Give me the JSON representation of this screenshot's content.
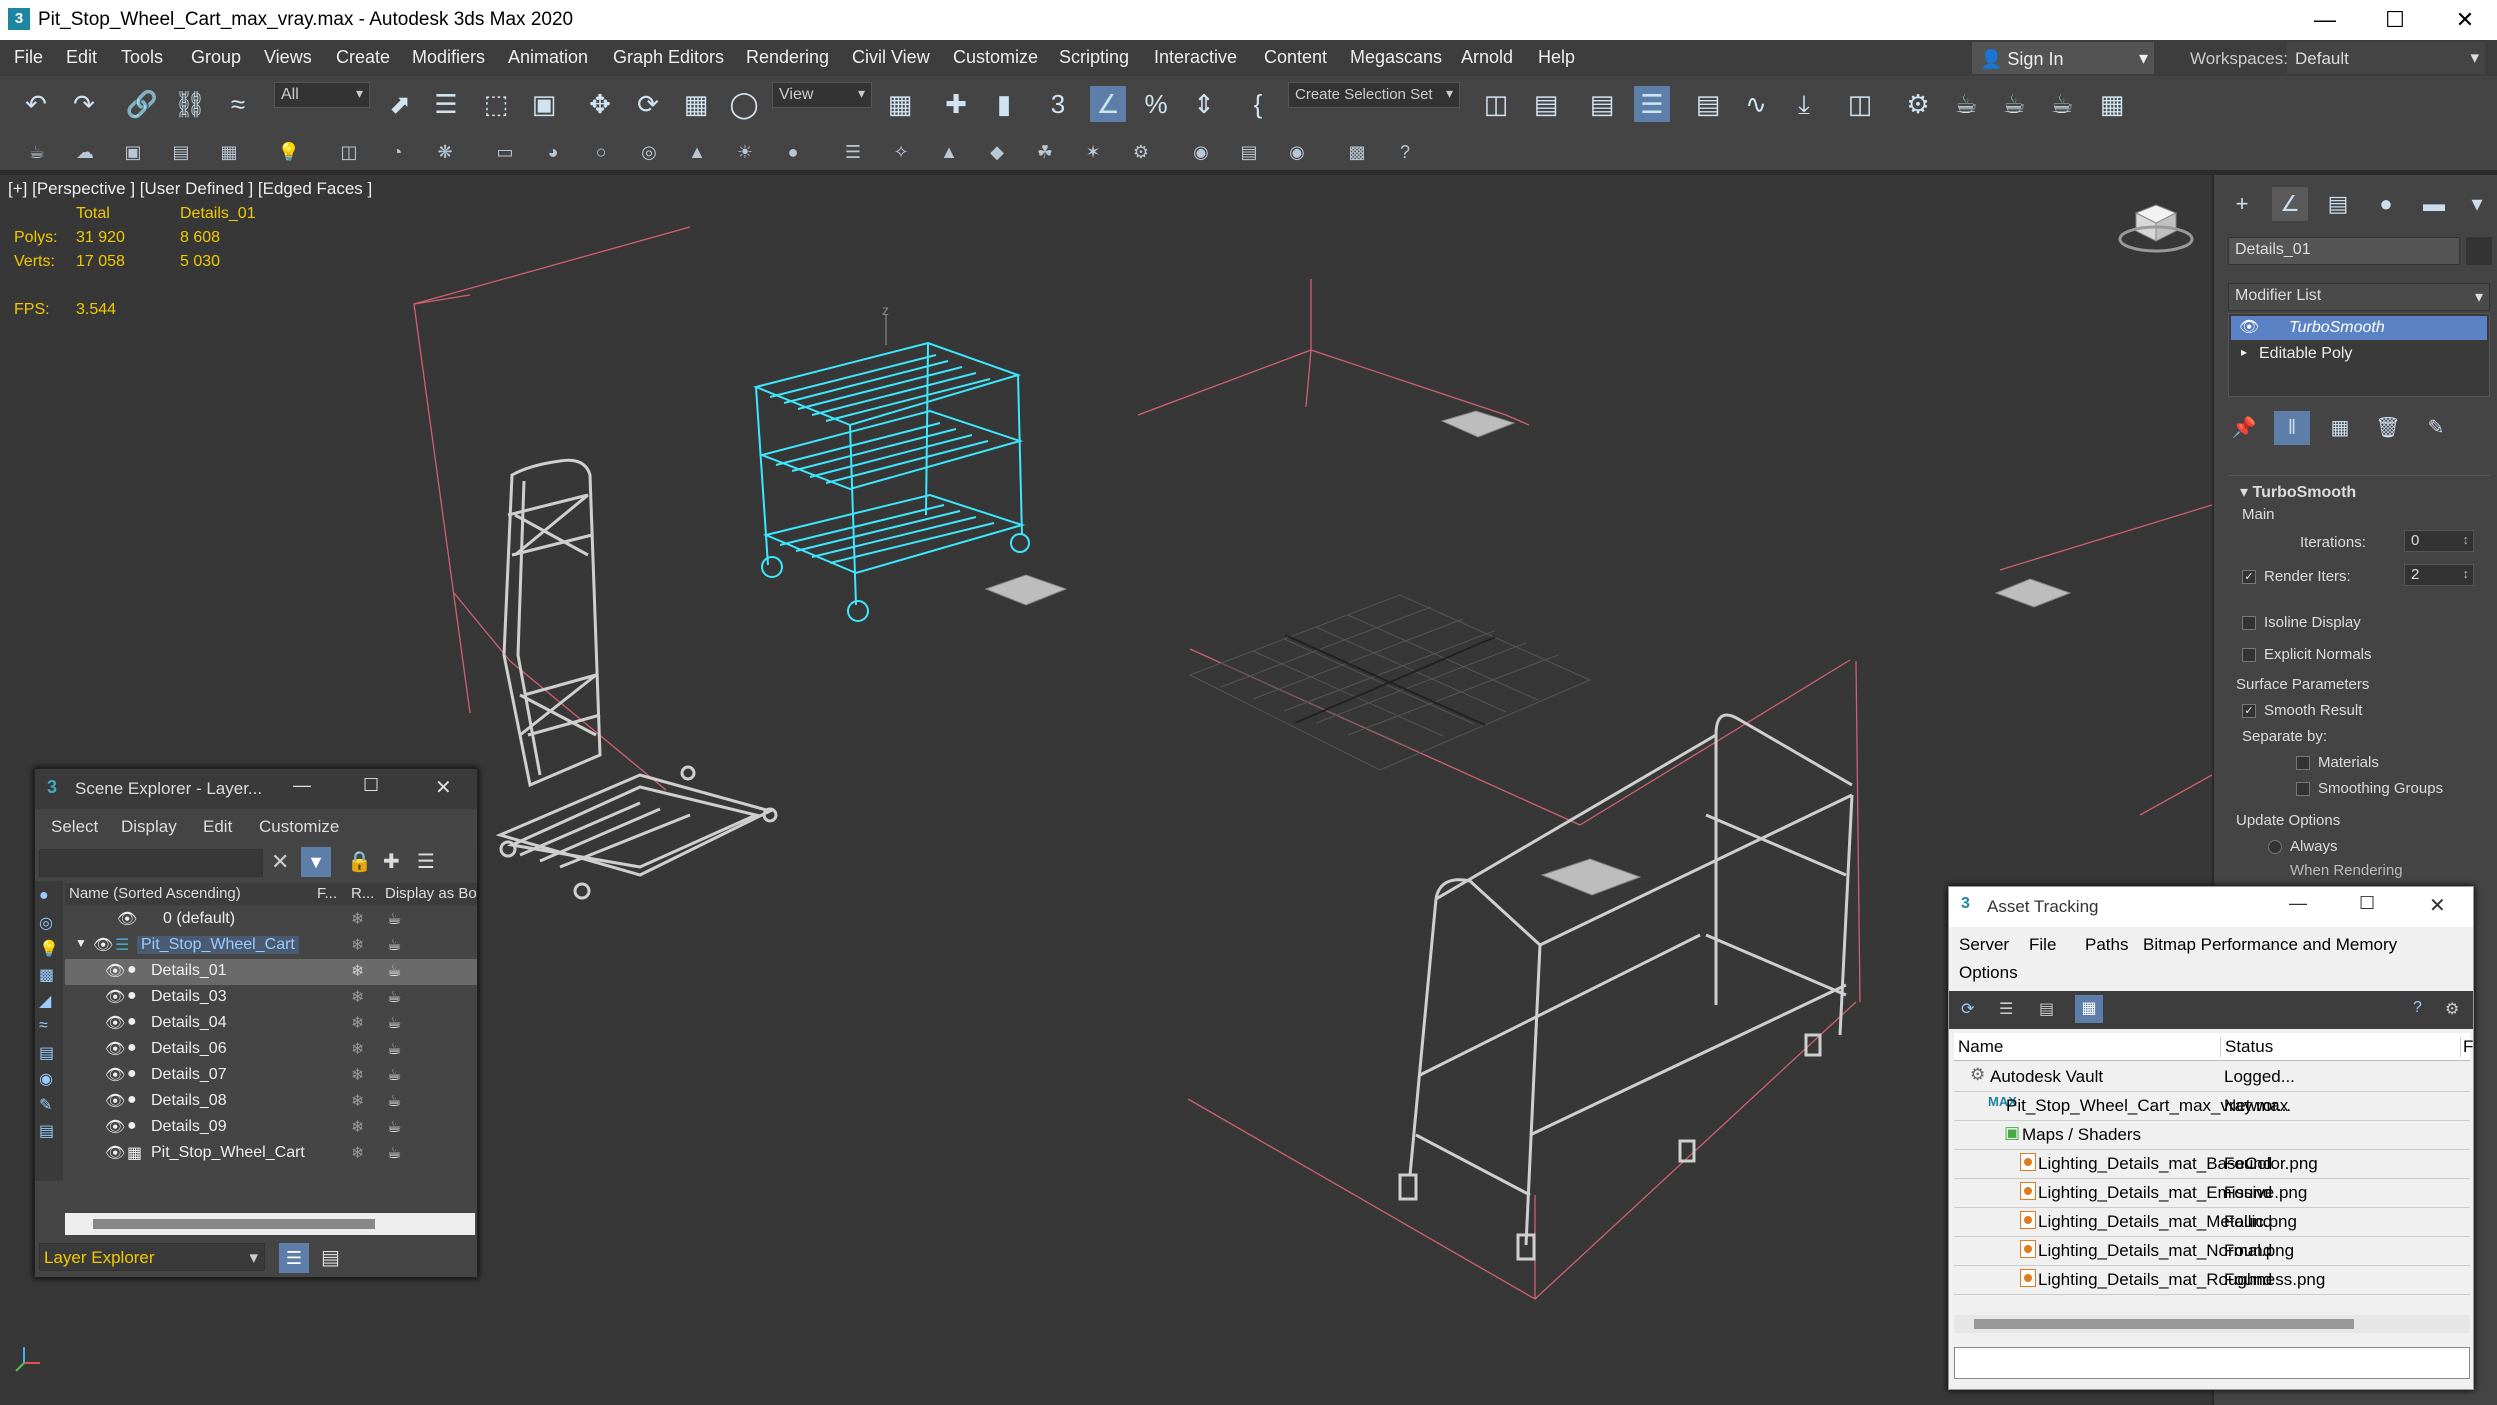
{
  "window": {
    "title": "Pit_Stop_Wheel_Cart_max_vray.max - Autodesk 3ds Max 2020",
    "app_icon": "3"
  },
  "menu": [
    "File",
    "Edit",
    "Tools",
    "Group",
    "Views",
    "Create",
    "Modifiers",
    "Animation",
    "Graph Editors",
    "Rendering",
    "Civil View",
    "Customize",
    "Scripting",
    "Interactive",
    "Content",
    "Megascans",
    "Arnold",
    "Help"
  ],
  "signin": "Sign In",
  "workspaces": {
    "label": "Workspaces:",
    "value": "Default"
  },
  "toolbar": {
    "filter": "All",
    "coord": "View",
    "selection_set": "Create Selection Set",
    "snap_label": "3"
  },
  "viewport": {
    "label": "[+] [Perspective ] [User Defined ] [Edged Faces ]",
    "stats": {
      "col_total": "Total",
      "col_sel": "Details_01",
      "polys_label": "Polys:",
      "polys_total": "31 920",
      "polys_sel": "8 608",
      "verts_label": "Verts:",
      "verts_total": "17 058",
      "verts_sel": "5 030",
      "fps_label": "FPS:",
      "fps": "3.544"
    },
    "axis_z": "z"
  },
  "command_panel": {
    "object_name": "Details_01",
    "modifier_list": "Modifier List",
    "stack": [
      "TurboSmooth",
      "Editable Poly"
    ],
    "rollout": "TurboSmooth",
    "main": "Main",
    "iterations_label": "Iterations:",
    "iterations": "0",
    "render_iters_label": "Render Iters:",
    "render_iters": "2",
    "isoline": "Isoline Display",
    "explicit": "Explicit Normals",
    "surface": "Surface Parameters",
    "smooth_result": "Smooth Result",
    "separate_by": "Separate by:",
    "materials": "Materials",
    "smoothing_groups": "Smoothing Groups",
    "update_options": "Update Options",
    "always": "Always",
    "when_rendering": "When Rendering"
  },
  "scene_explorer": {
    "title": "Scene Explorer - Layer...",
    "menu": [
      "Select",
      "Display",
      "Edit",
      "Customize"
    ],
    "columns": [
      "Name (Sorted Ascending)",
      "F...",
      "R...",
      "Display as Bo"
    ],
    "rows": [
      "0 (default)",
      "Pit_Stop_Wheel_Cart",
      "Details_01",
      "Details_03",
      "Details_04",
      "Details_06",
      "Details_07",
      "Details_08",
      "Details_09",
      "Pit_Stop_Wheel_Cart"
    ],
    "footer": "Layer Explorer"
  },
  "asset_tracking": {
    "title": "Asset Tracking",
    "menu": [
      "Server",
      "File",
      "Paths",
      "Bitmap Performance and Memory",
      "Options"
    ],
    "columns": [
      "Name",
      "Status",
      "F"
    ],
    "rows": [
      {
        "name": "Autodesk Vault",
        "status": "Logged..."
      },
      {
        "name": "Pit_Stop_Wheel_Cart_max_vray.max",
        "status": "Networ..."
      },
      {
        "name": "Maps / Shaders",
        "status": ""
      },
      {
        "name": "Lighting_Details_mat_BaseColor.png",
        "status": "Found"
      },
      {
        "name": "Lighting_Details_mat_Emissive.png",
        "status": "Found"
      },
      {
        "name": "Lighting_Details_mat_Metallic.png",
        "status": "Found"
      },
      {
        "name": "Lighting_Details_mat_Normal.png",
        "status": "Found"
      },
      {
        "name": "Lighting_Details_mat_Roughness.png",
        "status": "Found"
      }
    ]
  }
}
